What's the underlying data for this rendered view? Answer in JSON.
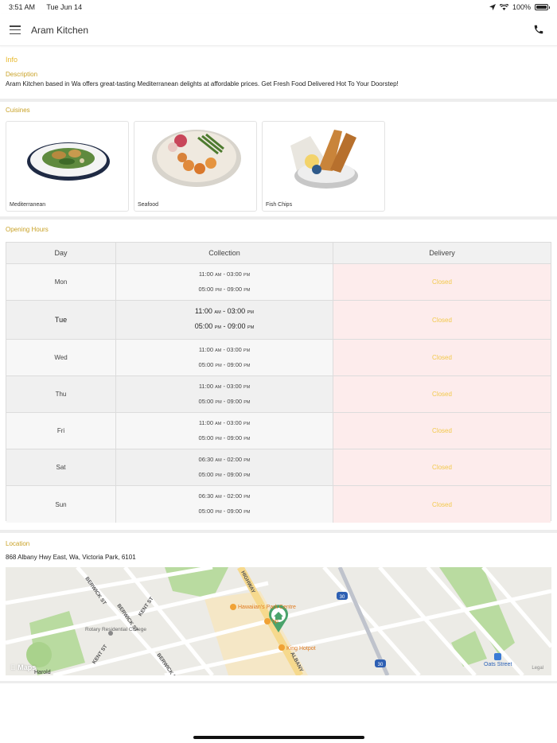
{
  "status_bar": {
    "time": "3:51 AM",
    "date": "Tue Jun 14",
    "battery": "100%"
  },
  "header": {
    "title": "Aram Kitchen"
  },
  "info": {
    "heading": "Info",
    "description_label": "Description",
    "description": "Aram Kitchen based in Wa offers great-tasting Mediterranean delights at affordable prices. Get Fresh Food Delivered Hot To Your Doorstep!"
  },
  "cuisines": {
    "label": "Cuisines",
    "items": [
      {
        "name": "Mediterranean"
      },
      {
        "name": "Seafood"
      },
      {
        "name": "Fish  Chips"
      }
    ]
  },
  "opening_hours": {
    "label": "Opening Hours",
    "columns": [
      "Day",
      "Collection",
      "Delivery"
    ],
    "rows": [
      {
        "day": "Mon",
        "c1_start": "11:00",
        "c1_start_ampm": "AM",
        "c1_end": "03:00",
        "c1_end_ampm": "PM",
        "c2_start": "05:00",
        "c2_start_ampm": "PM",
        "c2_end": "09:00",
        "c2_end_ampm": "PM",
        "delivery": "Closed"
      },
      {
        "day": "Tue",
        "c1_start": "11:00",
        "c1_start_ampm": "AM",
        "c1_end": "03:00",
        "c1_end_ampm": "PM",
        "c2_start": "05:00",
        "c2_start_ampm": "PM",
        "c2_end": "09:00",
        "c2_end_ampm": "PM",
        "delivery": "Closed"
      },
      {
        "day": "Wed",
        "c1_start": "11:00",
        "c1_start_ampm": "AM",
        "c1_end": "03:00",
        "c1_end_ampm": "PM",
        "c2_start": "05:00",
        "c2_start_ampm": "PM",
        "c2_end": "09:00",
        "c2_end_ampm": "PM",
        "delivery": "Closed"
      },
      {
        "day": "Thu",
        "c1_start": "11:00",
        "c1_start_ampm": "AM",
        "c1_end": "03:00",
        "c1_end_ampm": "PM",
        "c2_start": "05:00",
        "c2_start_ampm": "PM",
        "c2_end": "09:00",
        "c2_end_ampm": "PM",
        "delivery": "Closed"
      },
      {
        "day": "Fri",
        "c1_start": "11:00",
        "c1_start_ampm": "AM",
        "c1_end": "03:00",
        "c1_end_ampm": "PM",
        "c2_start": "05:00",
        "c2_start_ampm": "PM",
        "c2_end": "09:00",
        "c2_end_ampm": "PM",
        "delivery": "Closed"
      },
      {
        "day": "Sat",
        "c1_start": "06:30",
        "c1_start_ampm": "AM",
        "c1_end": "02:00",
        "c1_end_ampm": "PM",
        "c2_start": "05:00",
        "c2_start_ampm": "PM",
        "c2_end": "09:00",
        "c2_end_ampm": "PM",
        "delivery": "Closed"
      },
      {
        "day": "Sun",
        "c1_start": "06:30",
        "c1_start_ampm": "AM",
        "c1_end": "02:00",
        "c1_end_ampm": "PM",
        "c2_start": "05:00",
        "c2_start_ampm": "PM",
        "c2_end": "09:00",
        "c2_end_ampm": "PM",
        "delivery": "Closed"
      }
    ]
  },
  "location": {
    "label": "Location",
    "address": "868 Albany Hwy East, Wa, Victoria Park, 6101",
    "map": {
      "logo": "Maps",
      "legal": "Legal",
      "labels": {
        "berwick_st": "BERWICK ST",
        "kent_st": "KENT ST",
        "highway": "HIGHWAY",
        "albany": "ALBANY",
        "hawaiians": "Hawaiian's Park Centre",
        "king_hotpot": "King Hotpot",
        "rotary": "Rotary Residential College",
        "oats_street": "Oats Street",
        "harold": "Harold",
        "route_30": "30",
        "shp": "hp"
      }
    },
    "colors": {
      "park": "#b9dba0",
      "road": "#ffffff",
      "highway": "#f6d98d",
      "pin": "#4aa36b"
    }
  },
  "colors": {
    "accent": "#e8b92b",
    "closed_bg": "#fdecec",
    "closed_text": "#f2c94c"
  }
}
